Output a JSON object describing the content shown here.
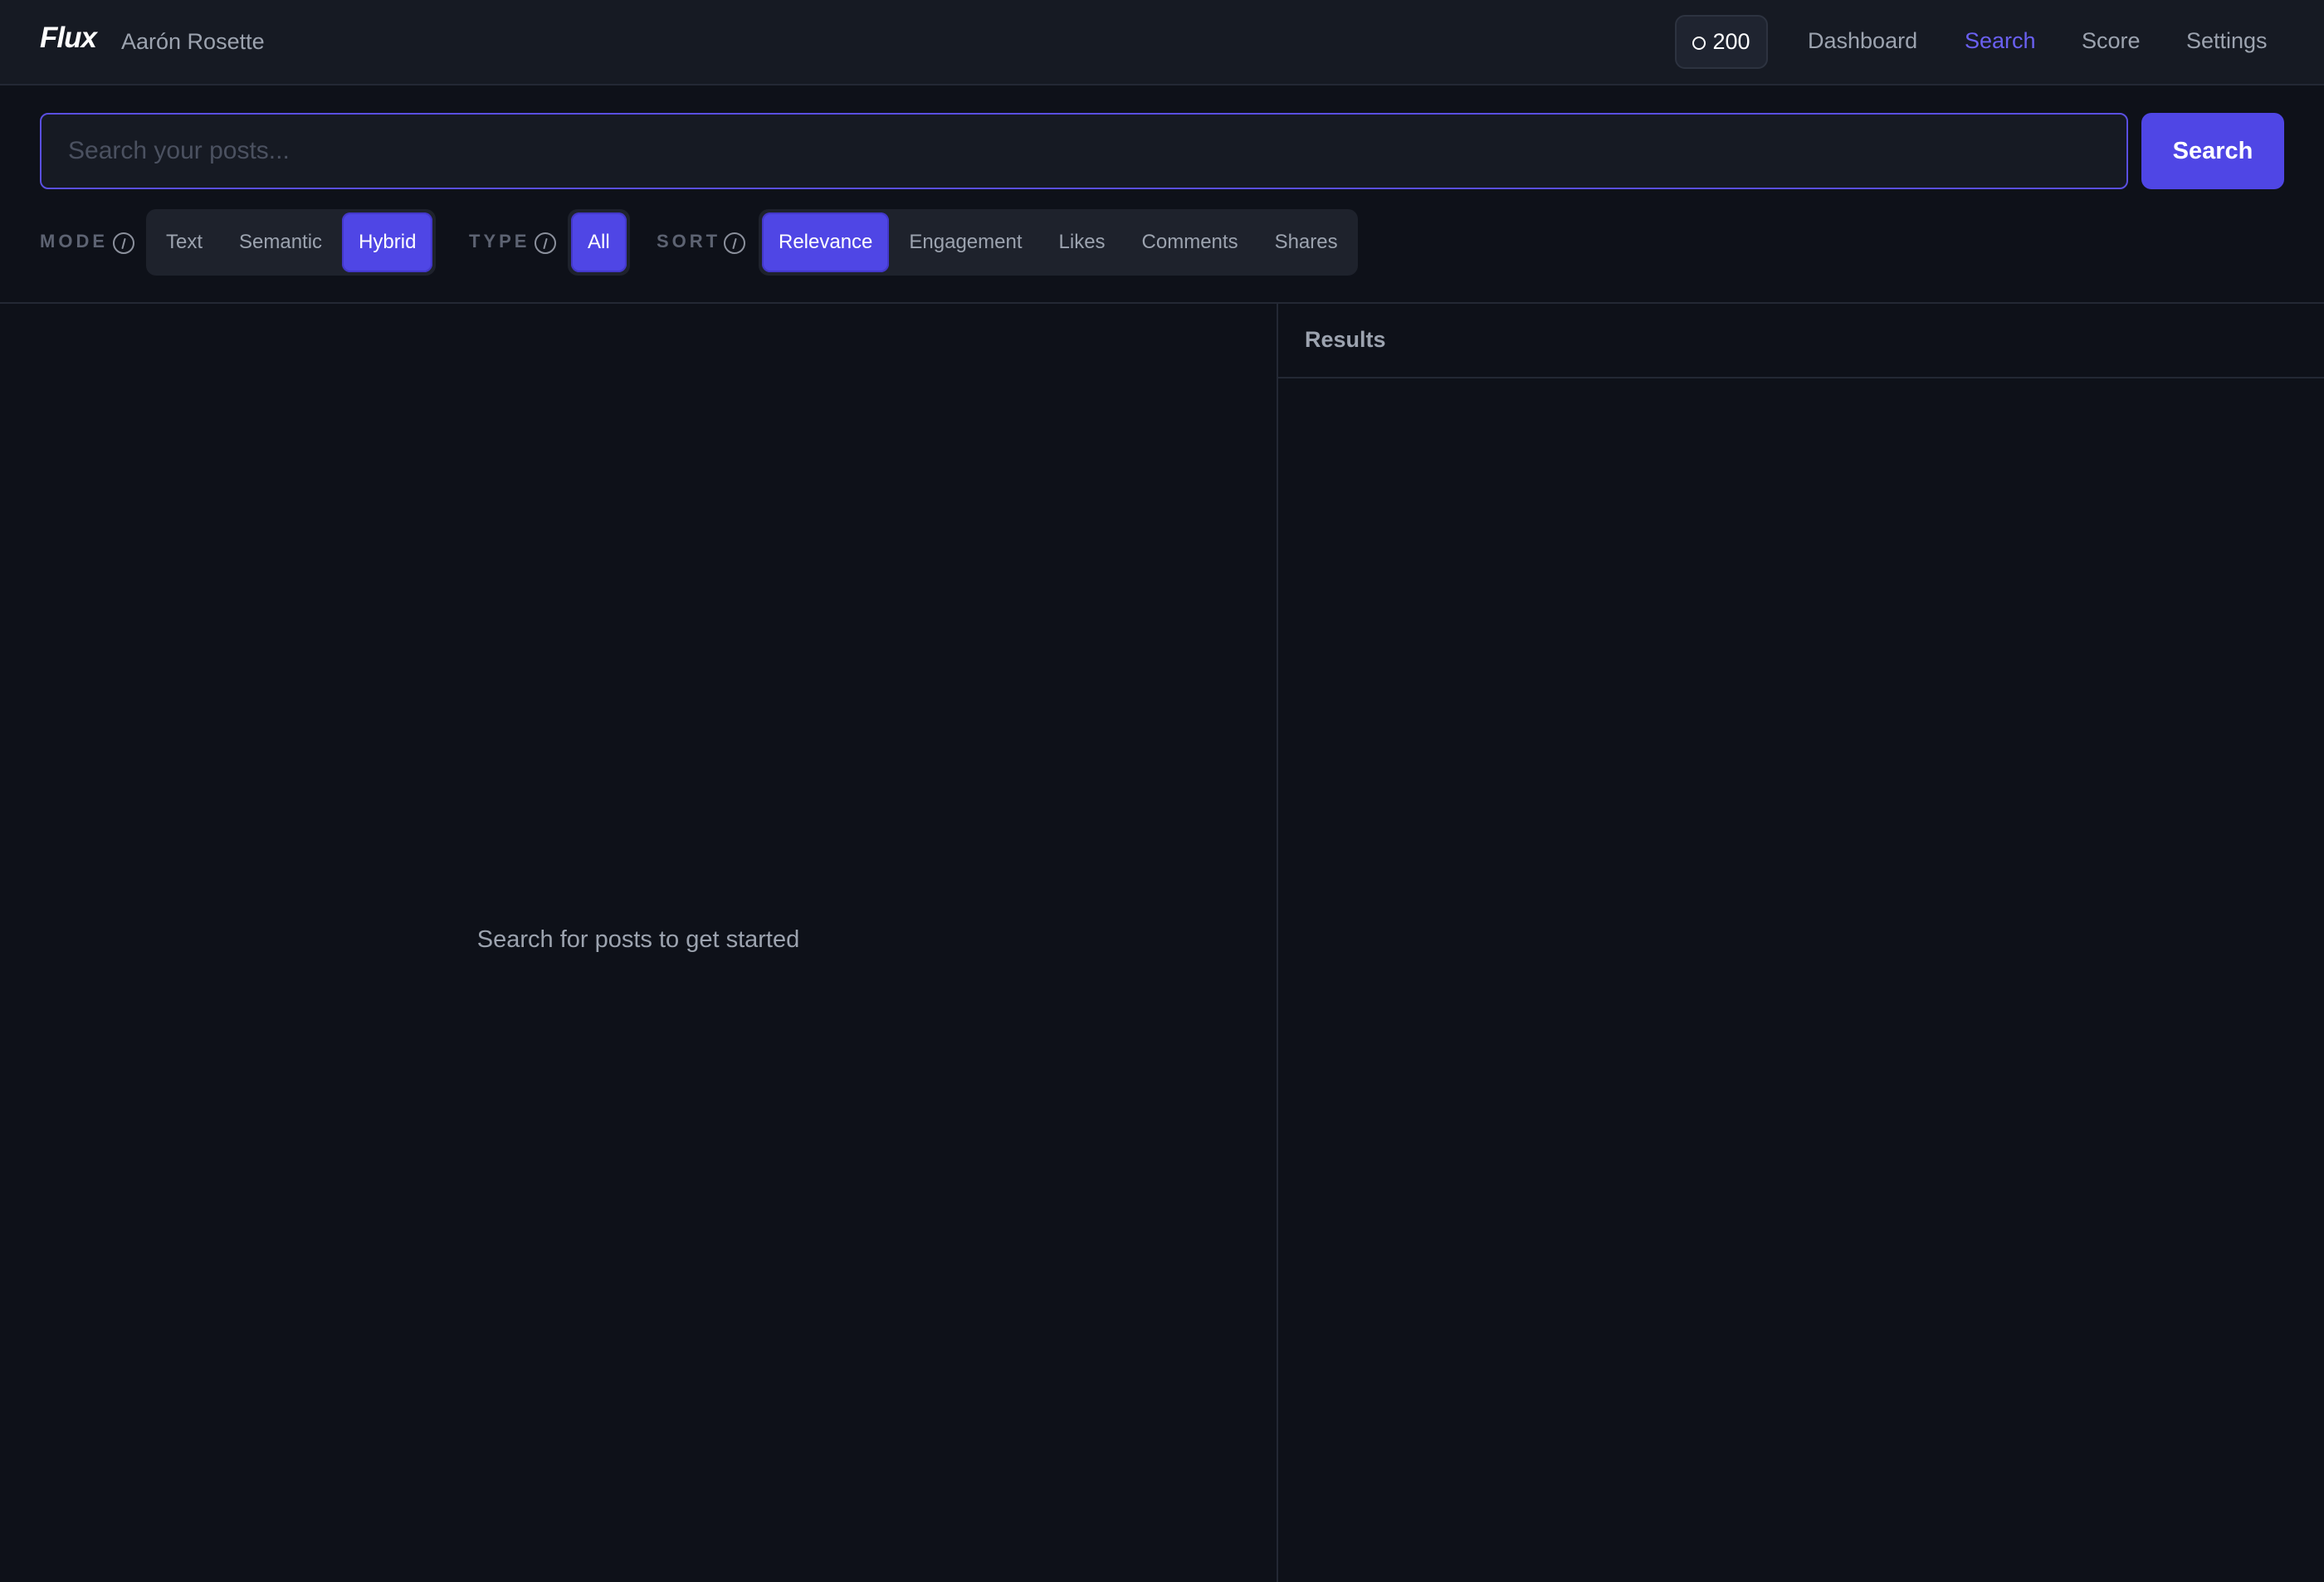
{
  "header": {
    "brand": "Flux",
    "username": "Aarón Rosette",
    "credits": "200",
    "nav": {
      "dashboard": "Dashboard",
      "search": "Search",
      "score": "Score",
      "settings": "Settings"
    },
    "active_nav": "Search"
  },
  "search": {
    "placeholder": "Search your posts...",
    "value": "",
    "button_label": "Search"
  },
  "filters": {
    "mode": {
      "label": "MODE",
      "options": [
        "Text",
        "Semantic",
        "Hybrid"
      ],
      "selected": "Hybrid"
    },
    "type": {
      "label": "TYPE",
      "options": [
        "All"
      ],
      "selected": "All"
    },
    "sort": {
      "label": "SORT",
      "options": [
        "Relevance",
        "Engagement",
        "Likes",
        "Comments",
        "Shares"
      ],
      "selected": "Relevance"
    }
  },
  "main": {
    "empty_message": "Search for posts to get started"
  },
  "results": {
    "title": "Results"
  },
  "colors": {
    "accent": "#4f46e5",
    "active_nav": "#6a60f0",
    "background": "#0e1119",
    "header_bg": "#161a23"
  },
  "icons": {
    "info": "info-icon",
    "credits": "coin-icon"
  }
}
